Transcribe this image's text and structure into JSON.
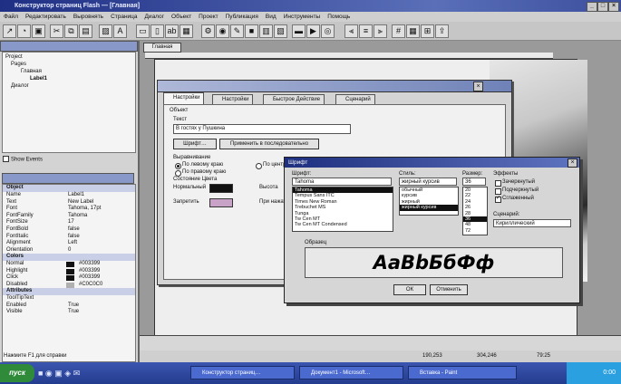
{
  "window": {
    "title": "Конструктор страниц Flash — [Главная]"
  },
  "menu": [
    "Файл",
    "Редактировать",
    "Выровнять",
    "Страница",
    "Диалог",
    "Объект",
    "Проект",
    "Публикация",
    "Вид",
    "Инструменты",
    "Помощь"
  ],
  "left_panel": {
    "tree": {
      "project": "Project",
      "pages": "Pages",
      "page": "Главная",
      "label": "Label1",
      "dialogs": "Диалог"
    },
    "show_events": "Show Events",
    "props_header": "Object",
    "properties": [
      {
        "k": "Name",
        "v": "Label1"
      },
      {
        "k": "Text",
        "v": "New Label"
      },
      {
        "k": "Font",
        "v": "Tahoma, 17pt"
      },
      {
        "k": "FontFamily",
        "v": "Tahoma"
      },
      {
        "k": "FontSize",
        "v": "17"
      },
      {
        "k": "FontBold",
        "v": "false"
      },
      {
        "k": "FontItalic",
        "v": "false"
      },
      {
        "k": "Alignment",
        "v": "Left"
      },
      {
        "k": "Orientation",
        "v": "0"
      },
      {
        "k": "Colors",
        "v": "",
        "group": true
      },
      {
        "k": "Normal",
        "v": "#003399",
        "swatch": "#111111"
      },
      {
        "k": "Highlight",
        "v": "#003399",
        "swatch": "#111111"
      },
      {
        "k": "Click",
        "v": "#003399",
        "swatch": "#111111"
      },
      {
        "k": "Disabled",
        "v": "#C0C0C0",
        "swatch": "#b0b0b0"
      },
      {
        "k": "Attributes",
        "v": "",
        "group": true
      },
      {
        "k": "ToolTipText",
        "v": ""
      },
      {
        "k": "Enabled",
        "v": "True"
      },
      {
        "k": "Visible",
        "v": "True"
      }
    ]
  },
  "editor": {
    "tab": "Главная"
  },
  "status": {
    "hint": "Нажмите F1 для справки",
    "coords": "190,253",
    "size": "304,246",
    "zoom": "79:25"
  },
  "taskbar": {
    "start": "пуск",
    "tasks": [
      "Конструктор страниц…",
      "Документ1 - Microsoft…",
      "Вставка - Paint"
    ],
    "time": "0:00"
  },
  "label_dialog": {
    "tabs": [
      "Настройки",
      "Настройки",
      "Быстрое Действие",
      "Сценарий"
    ],
    "object_label": "Объект",
    "text_label": "Текст",
    "text_value": "В гостях у Пушкина",
    "font_button": "Шрифт…",
    "apply_button": "Применить в последовательно",
    "align_group": "Выравнивание",
    "align_left": "По левому краю",
    "align_center": "По центру",
    "align_right": "По правому краю",
    "state_group": "Состояние Цвета",
    "normal_label": "Нормальный",
    "height_label": "Высота",
    "disabled_label": "Запретить",
    "hint_label": "При нажатии",
    "colors": {
      "normal": "#111111",
      "disabled": "#c9a3c7"
    }
  },
  "font_dialog": {
    "title": "Шрифт",
    "font_label": "Шрифт:",
    "font_value": "Tahoma",
    "fonts": [
      "Tahoma",
      "Tempus Sans ITC",
      "Times New Roman",
      "Trebuchet MS",
      "Tunga",
      "Tw Cen MT",
      "Tw Cen MT Condensed"
    ],
    "style_label": "Стиль:",
    "style_value": "жирный курсив",
    "styles": [
      "обычный",
      "курсив",
      "жирный",
      "жирный курсив"
    ],
    "size_label": "Размер:",
    "size_value": "36",
    "sizes": [
      "20",
      "22",
      "24",
      "26",
      "28",
      "36",
      "48",
      "72"
    ],
    "effects_label": "Эффекты",
    "effects": [
      {
        "label": "Зачеркнутый",
        "on": false
      },
      {
        "label": "Подчеркнутый",
        "on": false
      },
      {
        "label": "Сглаженный",
        "on": true
      }
    ],
    "charset_label": "Сценарий:",
    "charset_value": "Кириллический",
    "sample_label": "Образец",
    "sample_text": "AaBbБбФф",
    "ok": "ОК",
    "cancel": "Отменить"
  }
}
